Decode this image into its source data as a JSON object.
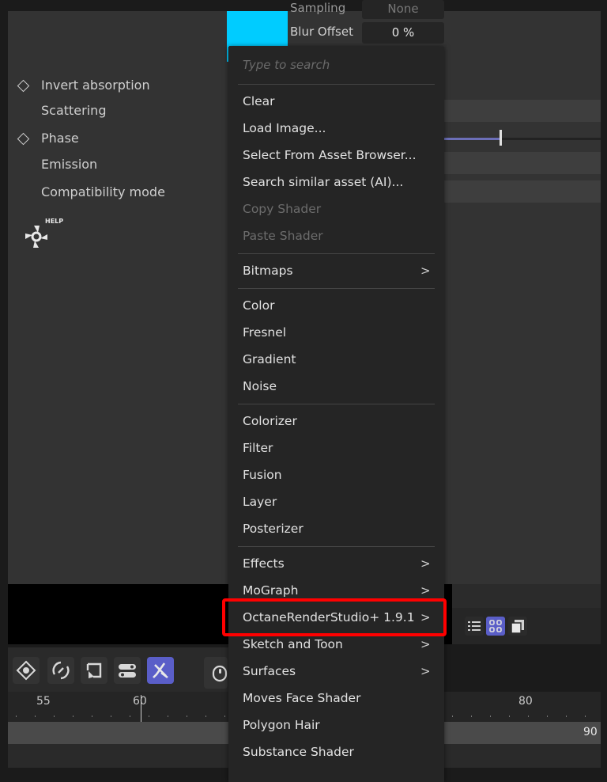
{
  "top_fields": {
    "sampling_label": "Sampling",
    "sampling_value": "None",
    "blur_offset_label": "Blur Offset",
    "blur_offset_value": "0 %"
  },
  "properties": [
    {
      "label": "Invert absorption",
      "keyframe": true
    },
    {
      "label": "Scattering",
      "keyframe": false
    },
    {
      "label": "Phase",
      "keyframe": true
    },
    {
      "label": "Emission",
      "keyframe": false
    },
    {
      "label": "Compatibility mode",
      "keyframe": false
    }
  ],
  "help_label": "HELP",
  "swatch_color": "#00ccff",
  "menu": {
    "search_placeholder": "Type to search",
    "groups": [
      [
        {
          "label": "Clear"
        },
        {
          "label": "Load Image..."
        },
        {
          "label": "Select From Asset Browser..."
        },
        {
          "label": "Search similar asset (AI)..."
        },
        {
          "label": "Copy Shader",
          "disabled": true
        },
        {
          "label": "Paste Shader",
          "disabled": true
        }
      ],
      [
        {
          "label": "Bitmaps",
          "submenu": true
        }
      ],
      [
        {
          "label": "Color"
        },
        {
          "label": "Fresnel"
        },
        {
          "label": "Gradient"
        },
        {
          "label": "Noise"
        }
      ],
      [
        {
          "label": "Colorizer"
        },
        {
          "label": "Filter"
        },
        {
          "label": "Fusion"
        },
        {
          "label": "Layer"
        },
        {
          "label": "Posterizer"
        }
      ],
      [
        {
          "label": "Effects",
          "submenu": true
        },
        {
          "label": "MoGraph",
          "submenu": true
        },
        {
          "label": "OctaneRenderStudio+ 1.9.1",
          "submenu": true,
          "highlighted": true
        },
        {
          "label": "Sketch and Toon",
          "submenu": true
        },
        {
          "label": "Surfaces",
          "submenu": true
        },
        {
          "label": "Moves Face Shader"
        },
        {
          "label": "Polygon Hair"
        },
        {
          "label": "Substance Shader"
        }
      ]
    ],
    "highlight_color": "#ff0000"
  },
  "timeline": {
    "ticks": [
      "55",
      "60",
      "80"
    ],
    "end_frame": "90"
  },
  "tools": [
    "move-keys-icon",
    "rotate-keys-icon",
    "frame-select-icon",
    "toggle-icon",
    "snap-off-icon"
  ],
  "view_buttons": [
    "list-view-icon",
    "grid-view-icon",
    "layers-view-icon"
  ]
}
